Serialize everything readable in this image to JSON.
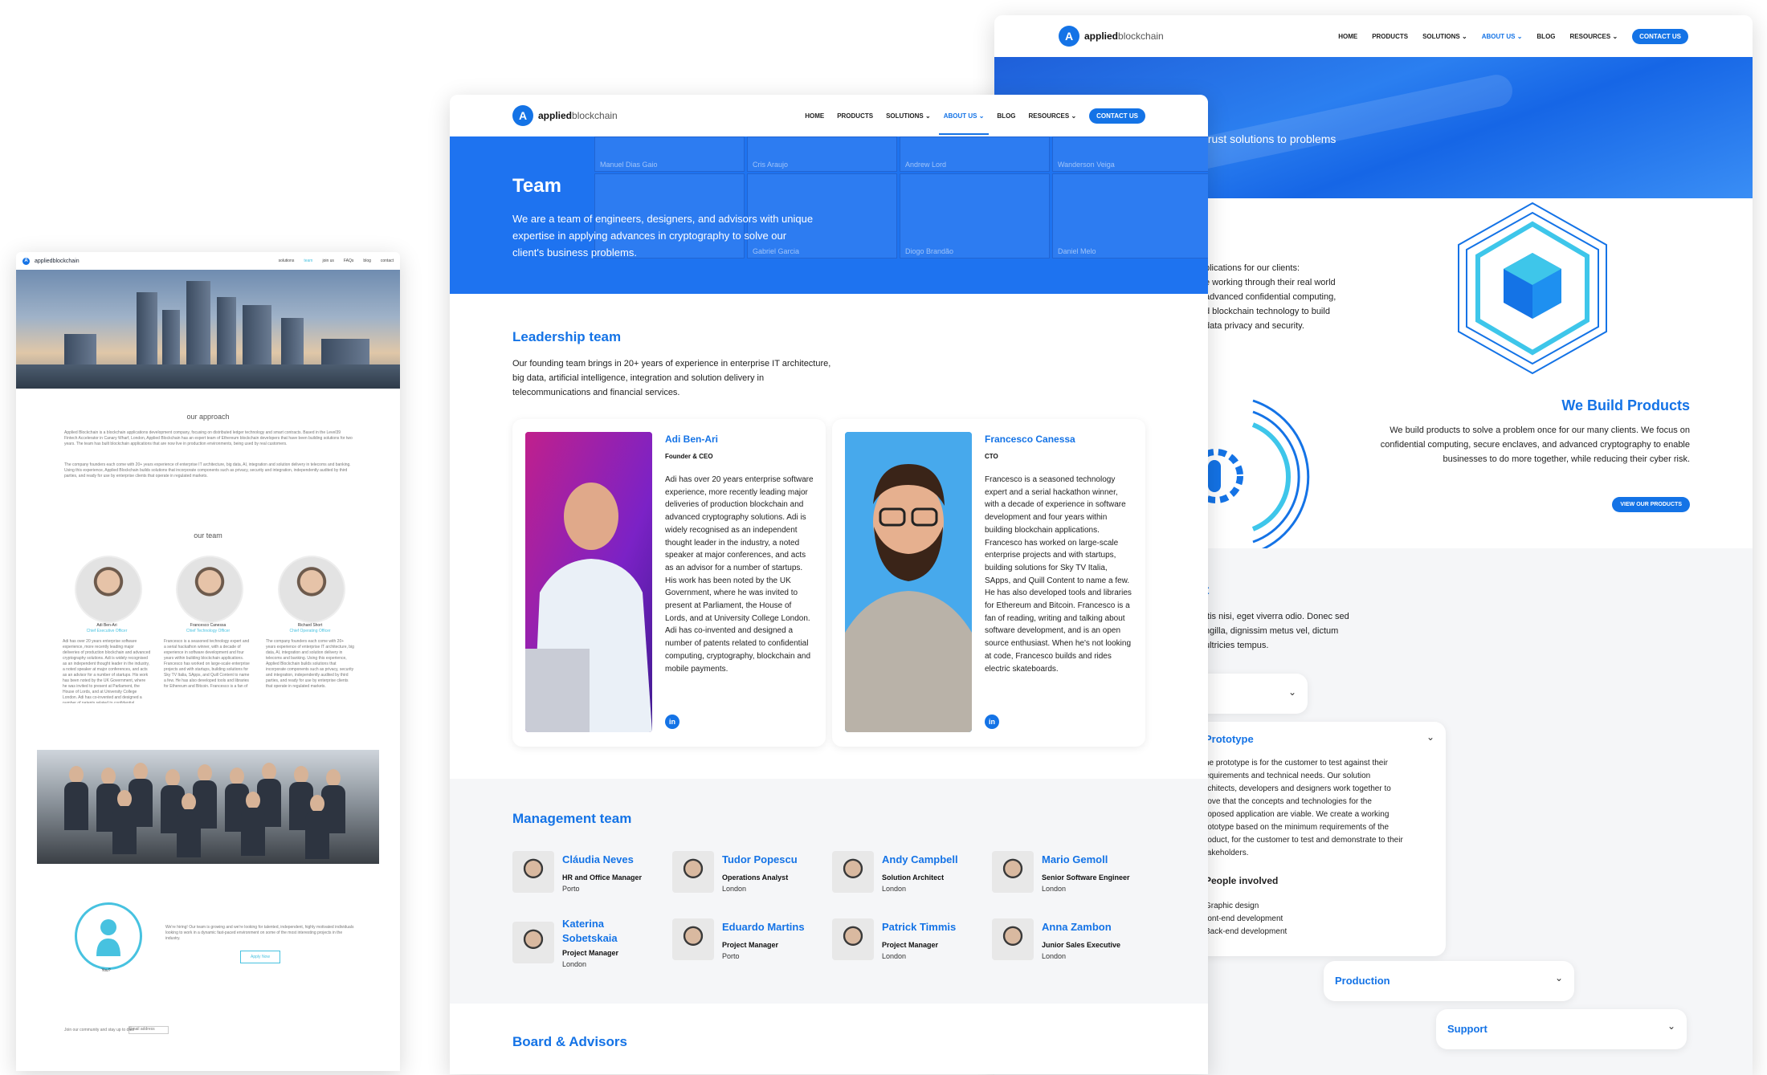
{
  "left_page": {
    "logo": "appliedblockchain",
    "nav": [
      "solutions",
      "team",
      "join us",
      "FAQs",
      "blog",
      "contact"
    ],
    "approach_title": "our approach",
    "approach_p1": "Applied Blockchain is a blockchain applications development company, focusing on distributed ledger technology and smart contracts. Based in the Level39 Fintech Accelerator in Canary Wharf, London, Applied Blockchain has an expert team of Ethereum blockchain developers that have been building solutions for two years. The team has built blockchain applications that are now live in production environments, being used by real customers.",
    "approach_p2": "The company founders each come with 20+ years experience of enterprise IT architecture, big data, AI, integration and solution delivery in telecoms and banking. Using this experience, Applied Blockchain builds solutions that incorporate components such as privacy, security and integration, independently audited by third parties, and ready for use by enterprise clients that operate in regulated markets.",
    "team_title": "our team",
    "members": [
      {
        "name": "Adi Ben-Ari",
        "role": "Chief Executive Officer"
      },
      {
        "name": "Francesco Canessa",
        "role": "Chief Technology Officer"
      },
      {
        "name": "Richard Short",
        "role": "Chief Operating Officer"
      }
    ],
    "you_label": "You?",
    "hiring_text": "We're hiring! Our team is growing and we're looking for talented, independent, highly motivated individuals looking to work in a dynamic fast-paced environment on some of the most interesting projects in the industry.",
    "apply_label": "Apply Now",
    "footer_text": "Join our community and stay up to date",
    "footer_input": "Email address"
  },
  "front_page": {
    "logo_bold": "applied",
    "logo_light": "blockchain",
    "nav": {
      "home": "HOME",
      "products": "PRODUCTS",
      "solutions": "SOLUTIONS",
      "about": "ABOUT US",
      "blog": "BLOG",
      "resources": "RESOURCES",
      "contact": "CONTACT US"
    },
    "hero": {
      "title": "Team",
      "subtitle": "We are a team of engineers, designers, and advisors with unique expertise in applying advances in cryptography to solve our client's business problems.",
      "tiles": [
        "Manuel Dias Gaio",
        "Cris Araujo",
        "Andrew Lord",
        "Wanderson Veiga",
        "Gabriel Garcia",
        "Diogo Brandão",
        "Daniel Melo"
      ]
    },
    "leadership": {
      "title": "Leadership team",
      "intro": "Our founding team brings in 20+ years of experience in enterprise IT architecture, big data, artificial intelligence, integration and solution delivery in telecommunications and financial services.",
      "people": [
        {
          "name": "Adi Ben-Ari",
          "role": "Founder & CEO",
          "bio": "Adi has over 20 years enterprise software experience, more recently leading major deliveries of production blockchain and advanced cryptography solutions. Adi is widely recognised as an independent thought leader in the industry, a noted speaker at major conferences, and acts as an advisor for a number of startups. His work has been noted by the UK Government, where he was invited to present at Parliament, the House of Lords, and at University College London. Adi has co-invented and designed a number of patents related to confidential computing, cryptography, blockchain and mobile payments."
        },
        {
          "name": "Francesco Canessa",
          "role": "CTO",
          "bio": "Francesco is a seasoned technology expert and a serial hackathon winner, with a decade of experience in software development and four years within building blockchain applications. Francesco has worked on large-scale enterprise projects and with startups, building solutions for Sky TV Italia, SApps, and Quill Content to name a few. He has also developed tools and libraries for Ethereum and Bitcoin. Francesco is a fan of reading, writing and talking about software development, and is an open source enthusiast. When he's not looking at code, Francesco builds and rides electric skateboards."
        }
      ],
      "linkedin": "in"
    },
    "management": {
      "title": "Management team",
      "people": [
        {
          "name": "Cláudia Neves",
          "role": "HR and Office Manager",
          "location": "Porto"
        },
        {
          "name": "Tudor Popescu",
          "role": "Operations Analyst",
          "location": "London"
        },
        {
          "name": "Andy Campbell",
          "role": "Solution Architect",
          "location": "London"
        },
        {
          "name": "Mario Gemoll",
          "role": "Senior Software Engineer",
          "location": "London"
        },
        {
          "name": "Katerina Sobetskaia",
          "role": "Project Manager",
          "location": "London"
        },
        {
          "name": "Eduardo Martins",
          "role": "Project Manager",
          "location": "Porto"
        },
        {
          "name": "Patrick Timmis",
          "role": "Project Manager",
          "location": "London"
        },
        {
          "name": "Anna Zambon",
          "role": "Junior Sales Executive",
          "location": "London"
        }
      ]
    },
    "board_title": "Board & Advisors"
  },
  "right_page": {
    "hero_text": "trust solutions to problems",
    "bullets": [
      "plications for our clients:",
      "e working through their real world",
      "advanced confidential computing,",
      "d blockchain technology to build",
      "data privacy and security."
    ],
    "wbp_title": "We Build Products",
    "wbp_text": "We build products to solve a problem once for our many clients. We focus on confidential computing, secure enclaves, and advanced cryptography to enable businesses to do more together, while reducing their cyber risk.",
    "wbp_button": "VIEW OUR PRODUCTS",
    "section_letter": "t",
    "lorem": [
      "ttis nisi, eget viverra odio. Donec sed",
      "ngilla, dignissim metus vel, dictum",
      "ultricies tempus."
    ],
    "accordion": {
      "prototype_title": "Prototype",
      "prototype_text": [
        "he prototype is for the customer to test against their",
        "equirements and technical needs. Our solution",
        "rchitects, developers and designers work together to",
        "rove that the concepts and technologies for the",
        "roposed application are viable. We create a working",
        "rototype based on the minimum requirements of the",
        "roduct, for the customer to test and demonstrate to their",
        "takeholders."
      ],
      "people_title": "People involved",
      "people": [
        "Graphic design",
        "ront-end development",
        "Back-end development"
      ],
      "production": "Production",
      "support": "Support"
    }
  }
}
